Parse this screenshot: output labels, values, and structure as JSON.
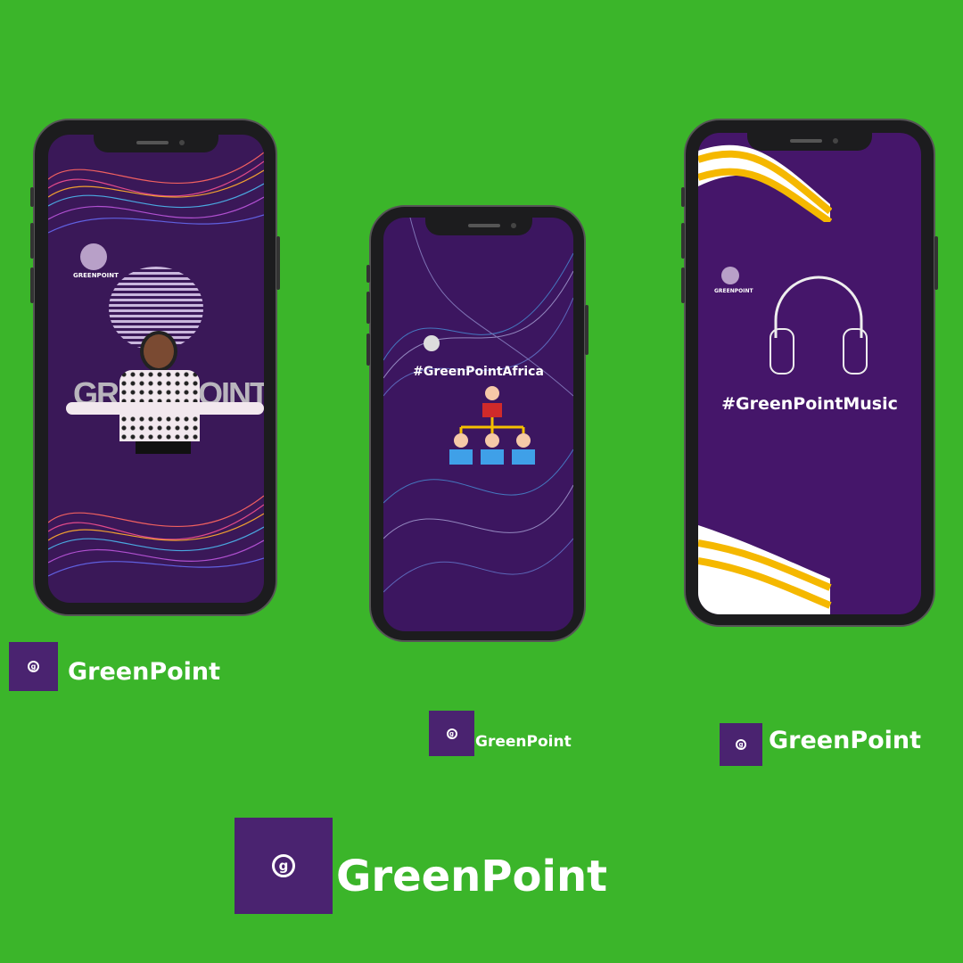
{
  "phones": [
    {
      "logo_text": "GREENPOINT",
      "big_text": "GREENPOINT"
    },
    {
      "hashtag": "#GreenPointAfrica"
    },
    {
      "logo_text": "GREENPOINT",
      "hashtag": "#GreenPointMusic"
    }
  ],
  "brand_labels": [
    "GreenPoint",
    "GreenPoint",
    "GreenPoint",
    "GreenPoint"
  ],
  "logo_glyph": "g",
  "colors": {
    "background": "#3bb52a",
    "purple": "#4a2370",
    "screen": "#3e1560",
    "accent_yellow": "#f5b800"
  }
}
